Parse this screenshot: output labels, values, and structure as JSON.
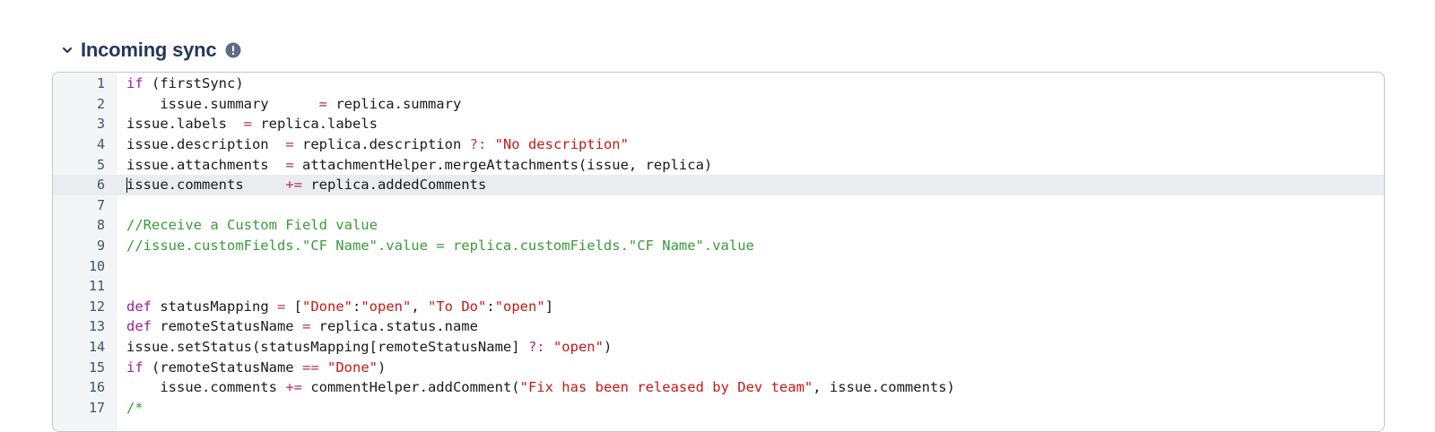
{
  "section": {
    "title": "Incoming sync",
    "chevron_icon": "chevron-down-icon",
    "info_icon": "info-icon"
  },
  "colors": {
    "keyword": "#9b2393",
    "string": "#c41a16",
    "comment": "#3a9a3a",
    "operator": "#b03060",
    "gutter_bg": "#f4f5f7",
    "active_line_bg": "#ebecf0"
  },
  "editor": {
    "active_line": 6,
    "lines": [
      {
        "n": "1",
        "tokens": [
          [
            "kw",
            "if"
          ],
          [
            "plain",
            " (firstSync)"
          ]
        ]
      },
      {
        "n": "2",
        "tokens": [
          [
            "plain",
            "    issue.summary      "
          ],
          [
            "op",
            "="
          ],
          [
            "plain",
            " replica.summary"
          ]
        ]
      },
      {
        "n": "3",
        "tokens": [
          [
            "plain",
            "issue.labels  "
          ],
          [
            "op",
            "="
          ],
          [
            "plain",
            " replica.labels"
          ]
        ]
      },
      {
        "n": "4",
        "tokens": [
          [
            "plain",
            "issue.description  "
          ],
          [
            "op",
            "="
          ],
          [
            "plain",
            " replica.description "
          ],
          [
            "op",
            "?:"
          ],
          [
            "plain",
            " "
          ],
          [
            "str",
            "\"No description\""
          ]
        ]
      },
      {
        "n": "5",
        "tokens": [
          [
            "plain",
            "issue.attachments  "
          ],
          [
            "op",
            "="
          ],
          [
            "plain",
            " attachmentHelper.mergeAttachments(issue, replica)"
          ]
        ]
      },
      {
        "n": "6",
        "tokens": [
          [
            "plain",
            "issue.comments     "
          ],
          [
            "op",
            "+="
          ],
          [
            "plain",
            " replica.addedComments"
          ]
        ]
      },
      {
        "n": "7",
        "tokens": []
      },
      {
        "n": "8",
        "tokens": [
          [
            "cm",
            "//Receive a Custom Field value"
          ]
        ]
      },
      {
        "n": "9",
        "tokens": [
          [
            "cm",
            "//issue.customFields.\"CF Name\".value = replica.customFields.\"CF Name\".value"
          ]
        ]
      },
      {
        "n": "10",
        "tokens": []
      },
      {
        "n": "11",
        "tokens": []
      },
      {
        "n": "12",
        "tokens": [
          [
            "kw",
            "def"
          ],
          [
            "plain",
            " statusMapping "
          ],
          [
            "op",
            "="
          ],
          [
            "plain",
            " ["
          ],
          [
            "str",
            "\"Done\""
          ],
          [
            "plain",
            ":"
          ],
          [
            "str",
            "\"open\""
          ],
          [
            "plain",
            ", "
          ],
          [
            "str",
            "\"To Do\""
          ],
          [
            "plain",
            ":"
          ],
          [
            "str",
            "\"open\""
          ],
          [
            "plain",
            "]"
          ]
        ]
      },
      {
        "n": "13",
        "tokens": [
          [
            "kw",
            "def"
          ],
          [
            "plain",
            " remoteStatusName "
          ],
          [
            "op",
            "="
          ],
          [
            "plain",
            " replica.status.name"
          ]
        ]
      },
      {
        "n": "14",
        "tokens": [
          [
            "plain",
            "issue.setStatus(statusMapping[remoteStatusName] "
          ],
          [
            "op",
            "?:"
          ],
          [
            "plain",
            " "
          ],
          [
            "str",
            "\"open\""
          ],
          [
            "plain",
            ")"
          ]
        ]
      },
      {
        "n": "15",
        "tokens": [
          [
            "kw",
            "if"
          ],
          [
            "plain",
            " (remoteStatusName "
          ],
          [
            "op",
            "=="
          ],
          [
            "plain",
            " "
          ],
          [
            "str",
            "\"Done\""
          ],
          [
            "plain",
            ")"
          ]
        ]
      },
      {
        "n": "16",
        "tokens": [
          [
            "plain",
            "    issue.comments "
          ],
          [
            "op",
            "+="
          ],
          [
            "plain",
            " commentHelper.addComment("
          ],
          [
            "str",
            "\"Fix has been released by Dev team\""
          ],
          [
            "plain",
            ", issue.comments)"
          ]
        ]
      },
      {
        "n": "17",
        "tokens": [
          [
            "cm",
            "/*"
          ]
        ]
      }
    ]
  }
}
